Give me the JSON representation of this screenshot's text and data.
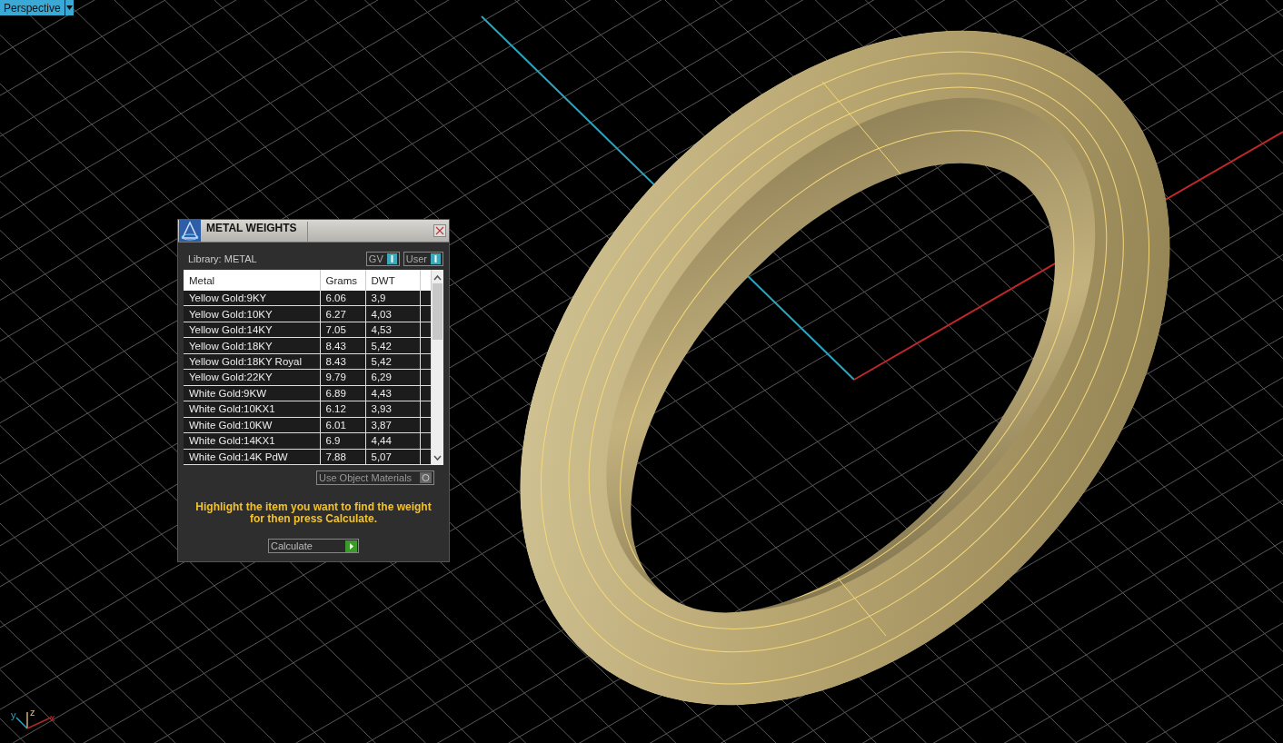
{
  "viewport": {
    "view_menu": "Perspective",
    "axis_labels": [
      "y",
      "z",
      "x"
    ]
  },
  "dialog": {
    "title": "METAL WEIGHTS",
    "library_label": "Library: METAL",
    "toggles": [
      "GV",
      "User"
    ],
    "table": {
      "columns": [
        "Metal",
        "Grams",
        "DWT"
      ],
      "rows": [
        [
          "Yellow Gold:9KY",
          "6.06",
          "3,9"
        ],
        [
          "Yellow Gold:10KY",
          "6.27",
          "4,03"
        ],
        [
          "Yellow Gold:14KY",
          "7.05",
          "4,53"
        ],
        [
          "Yellow Gold:18KY",
          "8.43",
          "5,42"
        ],
        [
          "Yellow Gold:18KY Royal",
          "8.43",
          "5,42"
        ],
        [
          "Yellow Gold:22KY",
          "9.79",
          "6,29"
        ],
        [
          "White Gold:9KW",
          "6.89",
          "4,43"
        ],
        [
          "White Gold:10KX1",
          "6.12",
          "3,93"
        ],
        [
          "White Gold:10KW",
          "6.01",
          "3,87"
        ],
        [
          "White Gold:14KX1",
          "6.9",
          "4,44"
        ],
        [
          "White Gold:14K PdW",
          "7.88",
          "5,07"
        ]
      ]
    },
    "object_materials_button": "Use Object Materials",
    "hint": "Highlight the item you want to find the weight for then press Calculate.",
    "calculate_button": "Calculate"
  }
}
